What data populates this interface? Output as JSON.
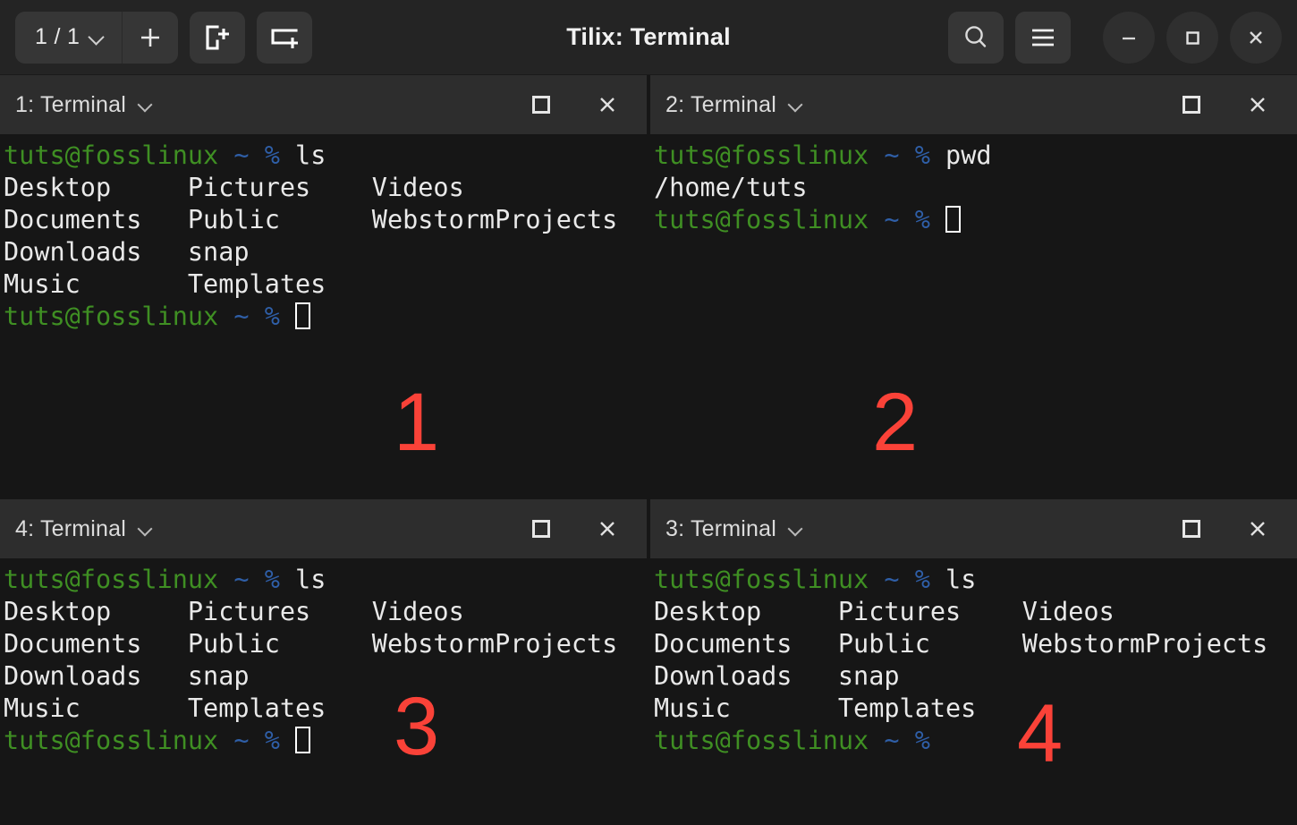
{
  "window": {
    "app_title": "Tilix: Terminal",
    "background": "#161616",
    "titlebar_background": "#242424",
    "header_background": "#2d2d2d",
    "annotation_color": "#fa4238",
    "prompt_green": "#3f8f23",
    "prompt_blue": "#2f5fa8",
    "text_white": "#e9e9e9"
  },
  "titlebar": {
    "session_selector_label": "1 / 1",
    "session_selector_icon": "chevron-down-icon",
    "add_session_label": "+",
    "add_session_icon": "plus-icon",
    "new_terminal_right_icon": "add-terminal-right-icon",
    "new_terminal_down_icon": "add-terminal-down-icon",
    "search_icon": "search-icon",
    "menu_icon": "hamburger-menu-icon",
    "minimize_icon": "minimize-icon",
    "maximize_icon": "maximize-icon",
    "close_icon": "close-icon"
  },
  "panes": [
    {
      "id": "pane-1",
      "title": "1: Terminal",
      "annotation": "1",
      "position": "top-left",
      "dropdown_icon": "chevron-down-icon",
      "maximize_icon": "maximize-icon",
      "close_icon": "close-icon",
      "lines": [
        {
          "segments": [
            {
              "text": "tuts@fosslinux ",
              "color": "green"
            },
            {
              "text": "~ ",
              "color": "blue"
            },
            {
              "text": "% ",
              "color": "blue"
            },
            {
              "text": "ls",
              "color": "white"
            }
          ]
        },
        {
          "segments": [
            {
              "text": "Desktop     Pictures    Videos",
              "color": "white"
            }
          ]
        },
        {
          "segments": [
            {
              "text": "Documents   Public      WebstormProjects",
              "color": "white"
            }
          ]
        },
        {
          "segments": [
            {
              "text": "Downloads   snap",
              "color": "white"
            }
          ]
        },
        {
          "segments": [
            {
              "text": "Music       Templates",
              "color": "white"
            }
          ]
        },
        {
          "segments": [
            {
              "text": "tuts@fosslinux ",
              "color": "green"
            },
            {
              "text": "~ ",
              "color": "blue"
            },
            {
              "text": "% ",
              "color": "blue"
            }
          ],
          "cursor": true
        }
      ]
    },
    {
      "id": "pane-2",
      "title": "2: Terminal",
      "annotation": "2",
      "position": "top-right",
      "dropdown_icon": "chevron-down-icon",
      "maximize_icon": "maximize-icon",
      "close_icon": "close-icon",
      "lines": [
        {
          "segments": [
            {
              "text": "tuts@fosslinux ",
              "color": "green"
            },
            {
              "text": "~ ",
              "color": "blue"
            },
            {
              "text": "% ",
              "color": "blue"
            },
            {
              "text": "pwd",
              "color": "white"
            }
          ]
        },
        {
          "segments": [
            {
              "text": "/home/tuts",
              "color": "white"
            }
          ]
        },
        {
          "segments": [
            {
              "text": "tuts@fosslinux ",
              "color": "green"
            },
            {
              "text": "~ ",
              "color": "blue"
            },
            {
              "text": "% ",
              "color": "blue"
            }
          ],
          "cursor": true
        }
      ]
    },
    {
      "id": "pane-4",
      "title": "4: Terminal",
      "annotation": "3",
      "position": "bottom-left",
      "dropdown_icon": "chevron-down-icon",
      "maximize_icon": "maximize-icon",
      "close_icon": "close-icon",
      "lines": [
        {
          "segments": [
            {
              "text": "tuts@fosslinux ",
              "color": "green"
            },
            {
              "text": "~ ",
              "color": "blue"
            },
            {
              "text": "% ",
              "color": "blue"
            },
            {
              "text": "ls",
              "color": "white"
            }
          ]
        },
        {
          "segments": [
            {
              "text": "Desktop     Pictures    Videos",
              "color": "white"
            }
          ]
        },
        {
          "segments": [
            {
              "text": "Documents   Public      WebstormProjects",
              "color": "white"
            }
          ]
        },
        {
          "segments": [
            {
              "text": "Downloads   snap",
              "color": "white"
            }
          ]
        },
        {
          "segments": [
            {
              "text": "Music       Templates",
              "color": "white"
            }
          ]
        },
        {
          "segments": [
            {
              "text": "tuts@fosslinux ",
              "color": "green"
            },
            {
              "text": "~ ",
              "color": "blue"
            },
            {
              "text": "% ",
              "color": "blue"
            }
          ],
          "cursor": true
        }
      ]
    },
    {
      "id": "pane-3",
      "title": "3: Terminal",
      "annotation": "4",
      "position": "bottom-right",
      "dropdown_icon": "chevron-down-icon",
      "maximize_icon": "maximize-icon",
      "close_icon": "close-icon",
      "lines": [
        {
          "segments": [
            {
              "text": "tuts@fosslinux ",
              "color": "green"
            },
            {
              "text": "~ ",
              "color": "blue"
            },
            {
              "text": "% ",
              "color": "blue"
            },
            {
              "text": "ls",
              "color": "white"
            }
          ]
        },
        {
          "segments": [
            {
              "text": "Desktop     Pictures    Videos",
              "color": "white"
            }
          ]
        },
        {
          "segments": [
            {
              "text": "Documents   Public      WebstormProjects",
              "color": "white"
            }
          ]
        },
        {
          "segments": [
            {
              "text": "Downloads   snap",
              "color": "white"
            }
          ]
        },
        {
          "segments": [
            {
              "text": "Music       Templates",
              "color": "white"
            }
          ]
        },
        {
          "segments": [
            {
              "text": "tuts@fosslinux ",
              "color": "green"
            },
            {
              "text": "~ ",
              "color": "blue"
            },
            {
              "text": "% ",
              "color": "blue"
            }
          ],
          "cursor": false
        }
      ]
    }
  ]
}
